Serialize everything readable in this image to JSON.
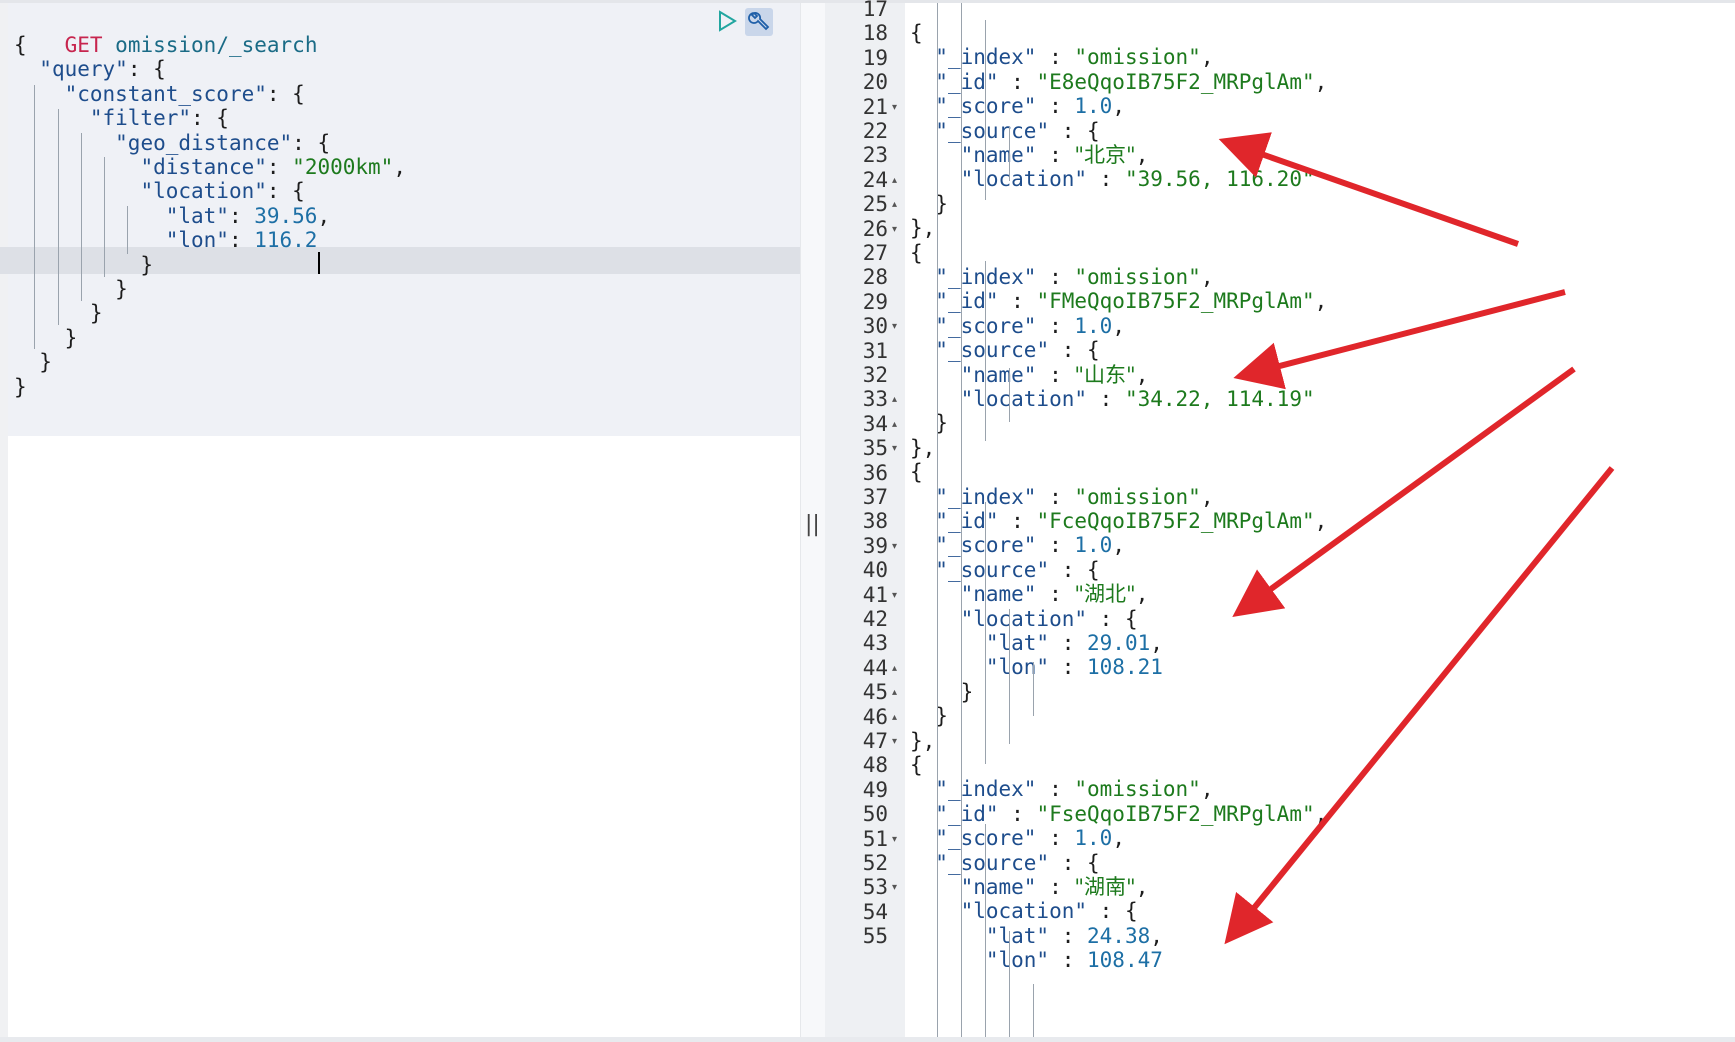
{
  "request": {
    "method": "GET",
    "path": "omission/_search",
    "lines": [
      "{",
      "  \"query\": {",
      "    \"constant_score\": {",
      "      \"filter\": {",
      "        \"geo_distance\": {",
      "          \"distance\": \"2000km\",",
      "          \"location\": {",
      "            \"lat\": 39.56,",
      "            \"lon\": 116.2",
      "          }",
      "        }",
      "      }",
      "    }",
      "  }",
      "}"
    ]
  },
  "toolbar": {
    "run_icon": "play-triangle-icon",
    "settings_icon": "wrench-icon"
  },
  "divider": {
    "handle": "||"
  },
  "response": {
    "line_numbers": [
      "17",
      "18",
      "19",
      "20",
      "21",
      "22",
      "23",
      "24",
      "25",
      "26",
      "27",
      "28",
      "29",
      "30",
      "31",
      "32",
      "33",
      "34",
      "35",
      "36",
      "37",
      "38",
      "39",
      "40",
      "41",
      "42",
      "43",
      "44",
      "45",
      "46",
      "47",
      "48",
      "49",
      "50",
      "51",
      "52",
      "53",
      "54",
      "55"
    ],
    "lines": [
      "          {",
      "            \"_index\" : \"omission\",",
      "            \"_id\" : \"E8eQqoIB75F2_MRPglAm\",",
      "            \"_score\" : 1.0,",
      "            \"_source\" : {",
      "              \"name\" : \"北京\",",
      "              \"location\" : \"39.56, 116.20\"",
      "            }",
      "          },",
      "          {",
      "            \"_index\" : \"omission\",",
      "            \"_id\" : \"FMeQqoIB75F2_MRPglAm\",",
      "            \"_score\" : 1.0,",
      "            \"_source\" : {",
      "              \"name\" : \"山东\",",
      "              \"location\" : \"34.22, 114.19\"",
      "            }",
      "          },",
      "          {",
      "            \"_index\" : \"omission\",",
      "            \"_id\" : \"FceQqoIB75F2_MRPglAm\",",
      "            \"_score\" : 1.0,",
      "            \"_source\" : {",
      "              \"name\" : \"湖北\",",
      "              \"location\" : {",
      "                \"lat\" : 29.01,",
      "                \"lon\" : 108.21",
      "              }",
      "            }",
      "          },",
      "          {",
      "            \"_index\" : \"omission\",",
      "            \"_id\" : \"FseQqoIB75F2_MRPglAm\",",
      "            \"_score\" : 1.0,",
      "            \"_source\" : {",
      "              \"name\" : \"湖南\",",
      "              \"location\" : {",
      "                \"lat\" : 24.38,",
      "                \"lon\" : 108.47"
    ],
    "fold_open_lines": [
      "21",
      "26",
      "30",
      "35",
      "39",
      "41",
      "47",
      "51",
      "53"
    ],
    "fold_close_lines": [
      "24",
      "25",
      "33",
      "34",
      "44",
      "45",
      "46"
    ]
  },
  "annotation": {
    "arrow_color": "#e0262b",
    "arrow_count": 4
  }
}
